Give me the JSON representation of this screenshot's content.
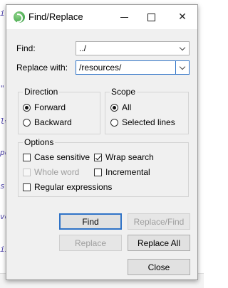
{
  "window": {
    "title": "Find/Replace"
  },
  "fields": {
    "find_label": "Find:",
    "find_value": "../",
    "replace_label": "Replace with:",
    "replace_value": "/resources/"
  },
  "direction": {
    "title": "Direction",
    "forward": "Forward",
    "backward": "Backward",
    "selected": "Forward"
  },
  "scope": {
    "title": "Scope",
    "all": "All",
    "selected_lines": "Selected lines",
    "selected": "All"
  },
  "options": {
    "title": "Options",
    "case_sensitive": {
      "label": "Case sensitive",
      "checked": false
    },
    "wrap_search": {
      "label": "Wrap search",
      "checked": true
    },
    "whole_word": {
      "label": "Whole word",
      "checked": false,
      "enabled": false
    },
    "incremental": {
      "label": "Incremental",
      "checked": false
    },
    "regex": {
      "label": "Regular expressions",
      "checked": false
    }
  },
  "buttons": {
    "find": "Find",
    "replace_find": "Replace/Find",
    "replace": "Replace",
    "replace_all": "Replace All",
    "close": "Close"
  },
  "background_glyphs": [
    "i",
    "\"",
    "l=",
    "ро",
    "s",
    "ve",
    "ii"
  ]
}
